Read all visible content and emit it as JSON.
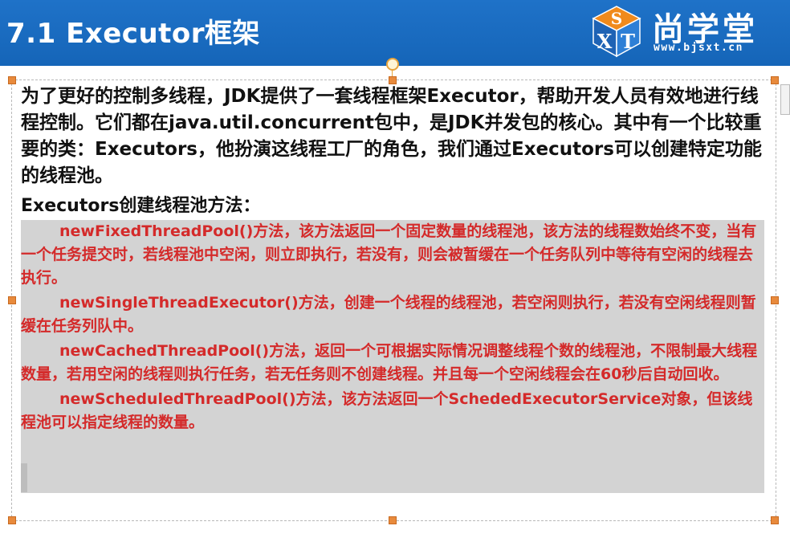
{
  "header": {
    "title": "7.1 Executor框架",
    "logo": {
      "cube_top": "S",
      "cube_left": "X",
      "cube_right": "T",
      "name": "尚学堂",
      "url": "www.bjsxt.cn"
    }
  },
  "intro": "为了更好的控制多线程，JDK提供了一套线程框架Executor，帮助开发人员有效地进行线程控制。它们都在java.util.concurrent包中，是JDK并发包的核心。其中有一个比较重要的类：Executors，他扮演这线程工厂的角色，我们通过Executors可以创建特定功能的线程池。",
  "subheading": "Executors创建线程池方法：",
  "methods": [
    {
      "name": "newFixedThreadPool()",
      "desc": "方法，该方法返回一个固定数量的线程池，该方法的线程数始终不变，当有一个任务提交时，若线程池中空闲，则立即执行，若没有，则会被暂缓在一个任务队列中等待有空闲的线程去执行。"
    },
    {
      "name": "newSingleThreadExecutor()",
      "desc": "方法，创建一个线程的线程池，若空闲则执行，若没有空闲线程则暂缓在任务列队中。"
    },
    {
      "name": "newCachedThreadPool()",
      "desc": "方法，返回一个可根据实际情况调整线程个数的线程池，不限制最大线程数量，若用空闲的线程则执行任务，若无任务则不创建线程。并且每一个空闲线程会在60秒后自动回收。"
    },
    {
      "name": "newScheduledThreadPool()",
      "desc": "方法，该方法返回一个SchededExecutorService对象，但该线程池可以指定线程的数量。"
    }
  ],
  "colors": {
    "header_bg": "#1565b8",
    "method_text": "#d42a2a",
    "highlight": "#d3d3d3",
    "handle": "#e88a3c"
  }
}
